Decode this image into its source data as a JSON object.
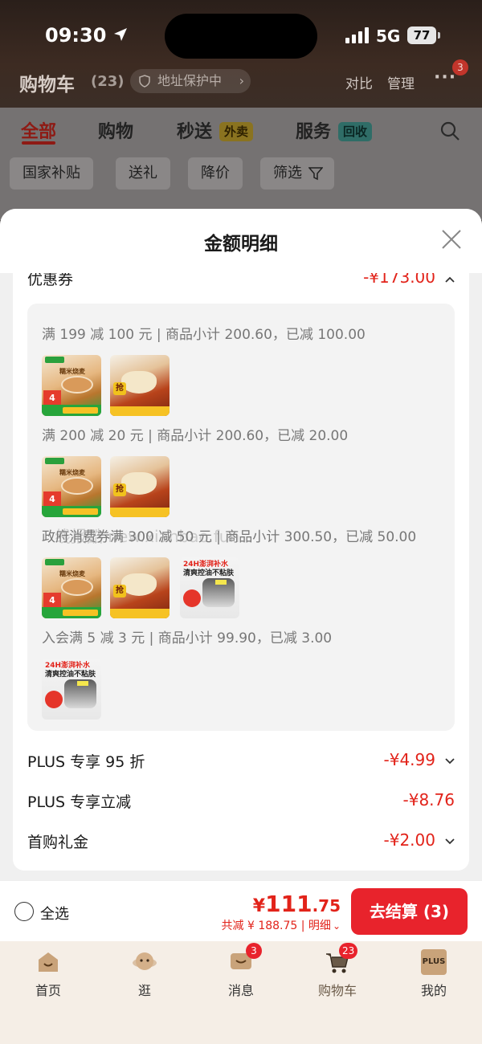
{
  "status": {
    "time": "09:30",
    "network": "5G",
    "battery": "77"
  },
  "header": {
    "title": "购物车",
    "count": "(23)",
    "address_protect": "地址保护中",
    "compare": "对比",
    "manage": "管理",
    "more_badge": "3"
  },
  "tabs": [
    {
      "label": "全部",
      "active": true
    },
    {
      "label": "购物"
    },
    {
      "label": "秒送",
      "chip": "外卖"
    },
    {
      "label": "服务",
      "chip": "回收"
    }
  ],
  "filters": [
    "国家补贴",
    "送礼",
    "降价",
    "筛选"
  ],
  "sheet": {
    "title": "金额明细",
    "coupon": {
      "label": "优惠券",
      "value": "-¥173.00"
    },
    "coupon_lines": [
      "满 199 减 100 元 | 商品小计 200.60，已减 100.00",
      "满 200 减 20 元 | 商品小计 200.60，已减 20.00",
      "政府消费券满 300 减 50 元 | 商品小计 300.50，已减 50.00",
      "入会满 5 减 3 元 | 商品小计 99.90，已减 3.00"
    ],
    "thumb_texts": {
      "rice_brand": "糯米烧麦",
      "rice_big": "4",
      "soup_grab": "抢",
      "sun_text1": "24H澎湃补水",
      "sun_text2": "清爽控油不粘肤"
    },
    "watermark": "线报酷 new.xianbao.fun",
    "plus95": {
      "label": "PLUS 专享 95 折",
      "value": "-¥4.99"
    },
    "plus_cut": {
      "label": "PLUS 专享立减",
      "value": "-¥8.76"
    },
    "first_gift": {
      "label": "首购礼金",
      "value": "-¥2.00"
    }
  },
  "checkout": {
    "select_all": "全选",
    "total_yen": "¥",
    "total_int": "111",
    "total_dec": ".75",
    "saved": "共减 ¥ 188.75 | 明细",
    "button": "去结算 (3)"
  },
  "tabbar": [
    {
      "label": "首页"
    },
    {
      "label": "逛"
    },
    {
      "label": "消息",
      "badge": "3"
    },
    {
      "label": "购物车",
      "badge": "23",
      "active": true
    },
    {
      "label": "我的",
      "icon_text": "PLUS"
    }
  ],
  "colors": {
    "accent": "#e2231a",
    "button": "#e8232c"
  }
}
